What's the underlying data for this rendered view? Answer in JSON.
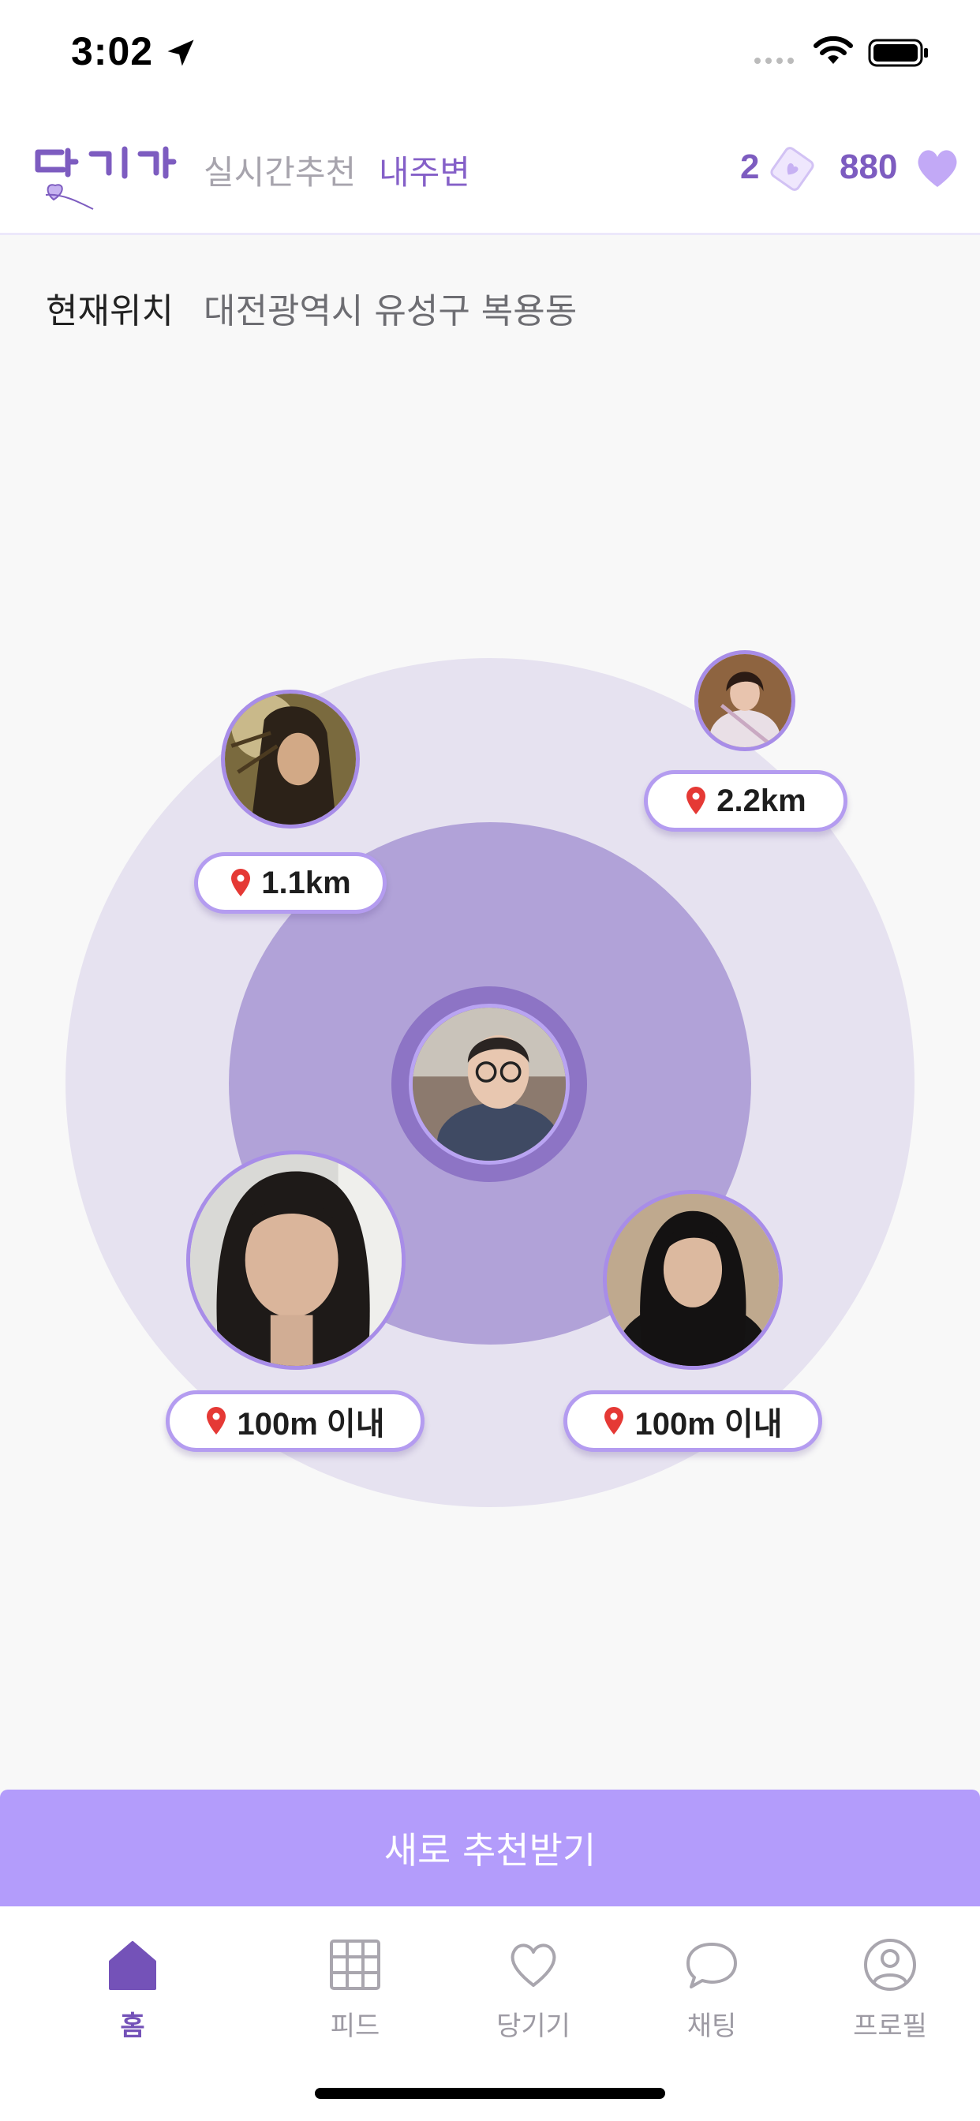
{
  "status_bar": {
    "time": "3:02"
  },
  "header": {
    "tabs": [
      {
        "label": "실시간추천",
        "active": false
      },
      {
        "label": "내주변",
        "active": true
      }
    ],
    "ticket_count": "2",
    "heart_count": "880",
    "icons": [
      "logo",
      "ticket-heart-icon",
      "heart-icon"
    ]
  },
  "location": {
    "label": "현재위치",
    "value": "대전광역시 유성구 복용동"
  },
  "nearby": {
    "me": {
      "avatar": "my-profile-photo"
    },
    "people": [
      {
        "distance": "1.1km",
        "icon": "location-pin-icon"
      },
      {
        "distance": "2.2km",
        "icon": "location-pin-icon"
      },
      {
        "distance": "100m 이내",
        "icon": "location-pin-icon"
      },
      {
        "distance": "100m 이내",
        "icon": "location-pin-icon"
      }
    ]
  },
  "cta": {
    "label": "새로 추천받기"
  },
  "tab_bar": {
    "items": [
      {
        "label": "홈",
        "icon": "home-icon",
        "active": true
      },
      {
        "label": "피드",
        "icon": "grid-icon",
        "active": false
      },
      {
        "label": "당기기",
        "icon": "heart-outline-icon",
        "active": false
      },
      {
        "label": "채팅",
        "icon": "chat-bubble-icon",
        "active": false
      },
      {
        "label": "프로필",
        "icon": "profile-icon",
        "active": false
      }
    ]
  },
  "colors": {
    "accent": "#8560c8",
    "cta": "#b39cfb",
    "ring_outer": "#e6e2f0",
    "ring_inner": "#b1a2d8",
    "pin": "#e53935"
  }
}
